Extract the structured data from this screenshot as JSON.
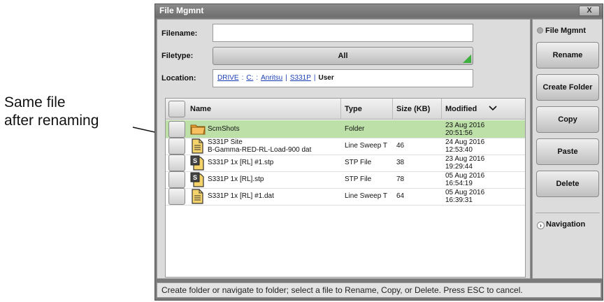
{
  "callout": {
    "line1": "Same file",
    "line2": "after renaming"
  },
  "window": {
    "title": "File Mgmnt",
    "close_label": "X"
  },
  "form": {
    "filename_label": "Filename:",
    "filename_value": "",
    "filetype_label": "Filetype:",
    "filetype_value": "All",
    "location_label": "Location:",
    "location_path": [
      "DRIVE",
      "C:",
      "Anritsu",
      "S331P"
    ],
    "location_separators": [
      ":",
      ":",
      "|",
      "|"
    ],
    "location_current": "User"
  },
  "table": {
    "headers": {
      "name": "Name",
      "type": "Type",
      "size": "Size (KB)",
      "modified": "Modified"
    },
    "sort_icon": "chevron-down-icon",
    "rows": [
      {
        "name": "ScmShots",
        "name2": "",
        "type": "Folder",
        "size": "",
        "date": "23 Aug 2016",
        "time": "20:51:56",
        "icon": "folder-icon",
        "selected": true
      },
      {
        "name": "S331P Site",
        "name2": "B-Gamma-RED-RL-Load-900 dat",
        "type": "Line Sweep T",
        "size": "46",
        "date": "24 Aug 2016",
        "time": "12:53:40",
        "icon": "document-icon",
        "selected": false
      },
      {
        "name": "S331P 1x [RL] #1.stp",
        "name2": "",
        "type": "STP File",
        "size": "38",
        "date": "23 Aug 2016",
        "time": "19:29:44",
        "icon": "stp-file-icon",
        "selected": false
      },
      {
        "name": "S331P 1x [RL].stp",
        "name2": "",
        "type": "STP File",
        "size": "78",
        "date": "05 Aug 2016",
        "time": "16:54:19",
        "icon": "stp-file-icon",
        "selected": false
      },
      {
        "name": "S331P 1x [RL] #1.dat",
        "name2": "",
        "type": "Line Sweep T",
        "size": "64",
        "date": "05 Aug 2016",
        "time": "16:39:31",
        "icon": "document-icon",
        "selected": false
      }
    ]
  },
  "sidebar": {
    "heading": "File Mgmnt",
    "buttons": [
      "Rename",
      "Create Folder",
      "Copy",
      "Paste",
      "Delete"
    ],
    "nav_label": "Navigation"
  },
  "status": {
    "text": "Create folder or navigate to folder; select a file to Rename, Copy, or Delete. Press ESC to cancel."
  },
  "colors": {
    "selected_row": "#bde0a8",
    "link": "#1a3fb5",
    "accent_green": "#3db03d"
  }
}
